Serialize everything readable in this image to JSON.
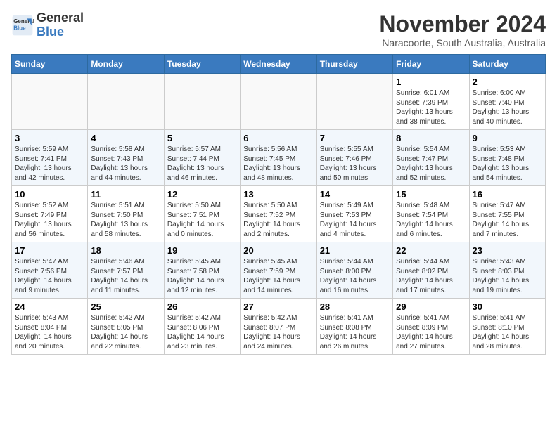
{
  "header": {
    "logo_line1": "General",
    "logo_line2": "Blue",
    "month": "November 2024",
    "location": "Naracoorte, South Australia, Australia"
  },
  "weekdays": [
    "Sunday",
    "Monday",
    "Tuesday",
    "Wednesday",
    "Thursday",
    "Friday",
    "Saturday"
  ],
  "weeks": [
    [
      {
        "day": "",
        "info": ""
      },
      {
        "day": "",
        "info": ""
      },
      {
        "day": "",
        "info": ""
      },
      {
        "day": "",
        "info": ""
      },
      {
        "day": "",
        "info": ""
      },
      {
        "day": "1",
        "info": "Sunrise: 6:01 AM\nSunset: 7:39 PM\nDaylight: 13 hours\nand 38 minutes."
      },
      {
        "day": "2",
        "info": "Sunrise: 6:00 AM\nSunset: 7:40 PM\nDaylight: 13 hours\nand 40 minutes."
      }
    ],
    [
      {
        "day": "3",
        "info": "Sunrise: 5:59 AM\nSunset: 7:41 PM\nDaylight: 13 hours\nand 42 minutes."
      },
      {
        "day": "4",
        "info": "Sunrise: 5:58 AM\nSunset: 7:43 PM\nDaylight: 13 hours\nand 44 minutes."
      },
      {
        "day": "5",
        "info": "Sunrise: 5:57 AM\nSunset: 7:44 PM\nDaylight: 13 hours\nand 46 minutes."
      },
      {
        "day": "6",
        "info": "Sunrise: 5:56 AM\nSunset: 7:45 PM\nDaylight: 13 hours\nand 48 minutes."
      },
      {
        "day": "7",
        "info": "Sunrise: 5:55 AM\nSunset: 7:46 PM\nDaylight: 13 hours\nand 50 minutes."
      },
      {
        "day": "8",
        "info": "Sunrise: 5:54 AM\nSunset: 7:47 PM\nDaylight: 13 hours\nand 52 minutes."
      },
      {
        "day": "9",
        "info": "Sunrise: 5:53 AM\nSunset: 7:48 PM\nDaylight: 13 hours\nand 54 minutes."
      }
    ],
    [
      {
        "day": "10",
        "info": "Sunrise: 5:52 AM\nSunset: 7:49 PM\nDaylight: 13 hours\nand 56 minutes."
      },
      {
        "day": "11",
        "info": "Sunrise: 5:51 AM\nSunset: 7:50 PM\nDaylight: 13 hours\nand 58 minutes."
      },
      {
        "day": "12",
        "info": "Sunrise: 5:50 AM\nSunset: 7:51 PM\nDaylight: 14 hours\nand 0 minutes."
      },
      {
        "day": "13",
        "info": "Sunrise: 5:50 AM\nSunset: 7:52 PM\nDaylight: 14 hours\nand 2 minutes."
      },
      {
        "day": "14",
        "info": "Sunrise: 5:49 AM\nSunset: 7:53 PM\nDaylight: 14 hours\nand 4 minutes."
      },
      {
        "day": "15",
        "info": "Sunrise: 5:48 AM\nSunset: 7:54 PM\nDaylight: 14 hours\nand 6 minutes."
      },
      {
        "day": "16",
        "info": "Sunrise: 5:47 AM\nSunset: 7:55 PM\nDaylight: 14 hours\nand 7 minutes."
      }
    ],
    [
      {
        "day": "17",
        "info": "Sunrise: 5:47 AM\nSunset: 7:56 PM\nDaylight: 14 hours\nand 9 minutes."
      },
      {
        "day": "18",
        "info": "Sunrise: 5:46 AM\nSunset: 7:57 PM\nDaylight: 14 hours\nand 11 minutes."
      },
      {
        "day": "19",
        "info": "Sunrise: 5:45 AM\nSunset: 7:58 PM\nDaylight: 14 hours\nand 12 minutes."
      },
      {
        "day": "20",
        "info": "Sunrise: 5:45 AM\nSunset: 7:59 PM\nDaylight: 14 hours\nand 14 minutes."
      },
      {
        "day": "21",
        "info": "Sunrise: 5:44 AM\nSunset: 8:00 PM\nDaylight: 14 hours\nand 16 minutes."
      },
      {
        "day": "22",
        "info": "Sunrise: 5:44 AM\nSunset: 8:02 PM\nDaylight: 14 hours\nand 17 minutes."
      },
      {
        "day": "23",
        "info": "Sunrise: 5:43 AM\nSunset: 8:03 PM\nDaylight: 14 hours\nand 19 minutes."
      }
    ],
    [
      {
        "day": "24",
        "info": "Sunrise: 5:43 AM\nSunset: 8:04 PM\nDaylight: 14 hours\nand 20 minutes."
      },
      {
        "day": "25",
        "info": "Sunrise: 5:42 AM\nSunset: 8:05 PM\nDaylight: 14 hours\nand 22 minutes."
      },
      {
        "day": "26",
        "info": "Sunrise: 5:42 AM\nSunset: 8:06 PM\nDaylight: 14 hours\nand 23 minutes."
      },
      {
        "day": "27",
        "info": "Sunrise: 5:42 AM\nSunset: 8:07 PM\nDaylight: 14 hours\nand 24 minutes."
      },
      {
        "day": "28",
        "info": "Sunrise: 5:41 AM\nSunset: 8:08 PM\nDaylight: 14 hours\nand 26 minutes."
      },
      {
        "day": "29",
        "info": "Sunrise: 5:41 AM\nSunset: 8:09 PM\nDaylight: 14 hours\nand 27 minutes."
      },
      {
        "day": "30",
        "info": "Sunrise: 5:41 AM\nSunset: 8:10 PM\nDaylight: 14 hours\nand 28 minutes."
      }
    ]
  ]
}
